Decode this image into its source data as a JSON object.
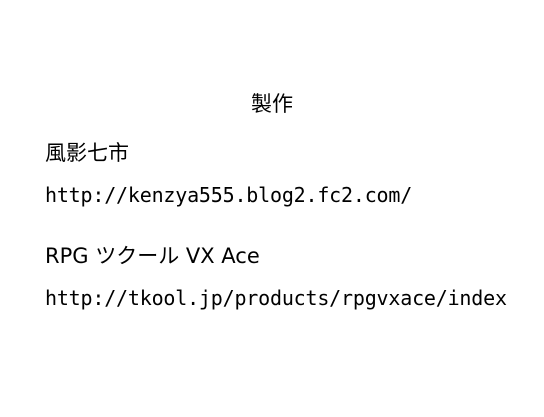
{
  "credits": {
    "heading": "製作",
    "author_name": "風影七市",
    "author_url": "http://kenzya555.blog2.fc2.com/",
    "tool_name": "RPG ツクール VX Ace",
    "tool_url": "http://tkool.jp/products/rpgvxace/index"
  },
  "colors": {
    "background": "#ffffff",
    "text": "#000000"
  }
}
